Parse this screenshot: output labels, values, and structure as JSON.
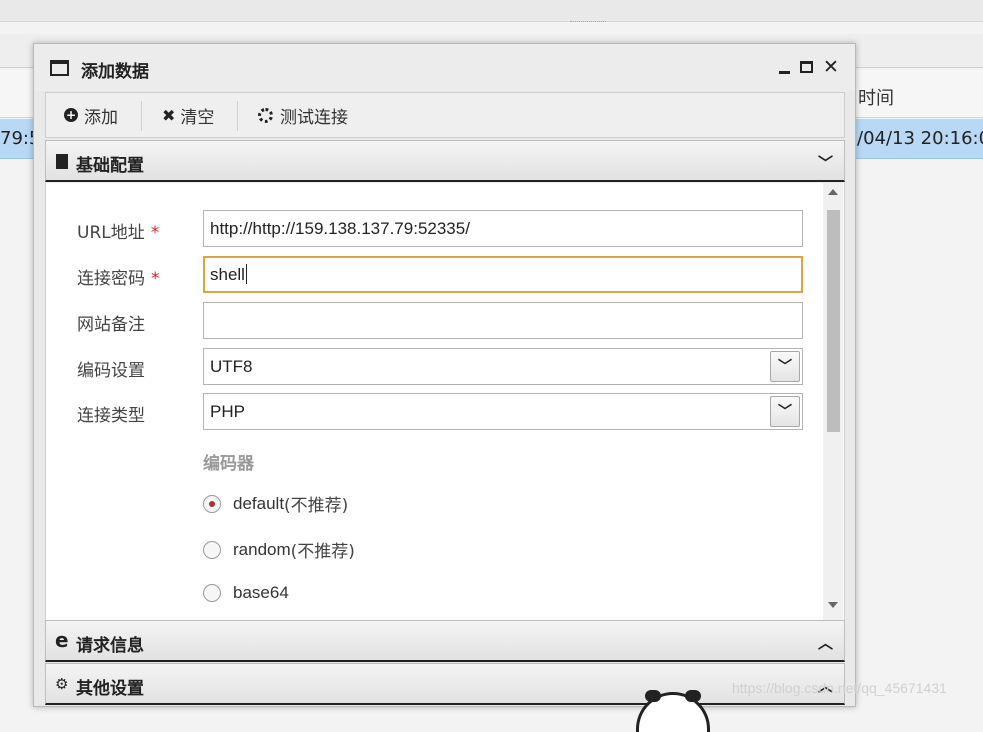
{
  "background": {
    "column_header_time": "时间",
    "row_left_fragment": "79:5",
    "row_right_fragment": "/04/13 20:16:0",
    "watermark": "https://blog.csdn.net/qq_45671431"
  },
  "dialog": {
    "title": "添加数据",
    "window_controls": {
      "minimize": "minimize",
      "maximize": "maximize",
      "close": "✕"
    },
    "toolbar": {
      "add_label": "添加",
      "clear_label": "清空",
      "test_label": "测试连接"
    },
    "sections": {
      "basic": "基础配置",
      "request": "请求信息",
      "other": "其他设置"
    },
    "form": {
      "url_label": "URL地址",
      "url_value": "http://http://159.138.137.79:52335/",
      "password_label": "连接密码",
      "password_value": "shell",
      "note_label": "网站备注",
      "note_value": "",
      "encoding_label": "编码设置",
      "encoding_value": "UTF8",
      "type_label": "连接类型",
      "type_value": "PHP",
      "required_mark": "*",
      "encoder_title": "编码器",
      "encoders": [
        {
          "name": "default",
          "note": " (不推荐)",
          "checked": true
        },
        {
          "name": "random",
          "note": " (不推荐)",
          "checked": false
        },
        {
          "name": "base64",
          "note": "",
          "checked": false
        }
      ]
    }
  },
  "colors": {
    "selected_row": "#b9d8f5",
    "focus_border": "#d9a640",
    "required_star": "#e02020"
  }
}
